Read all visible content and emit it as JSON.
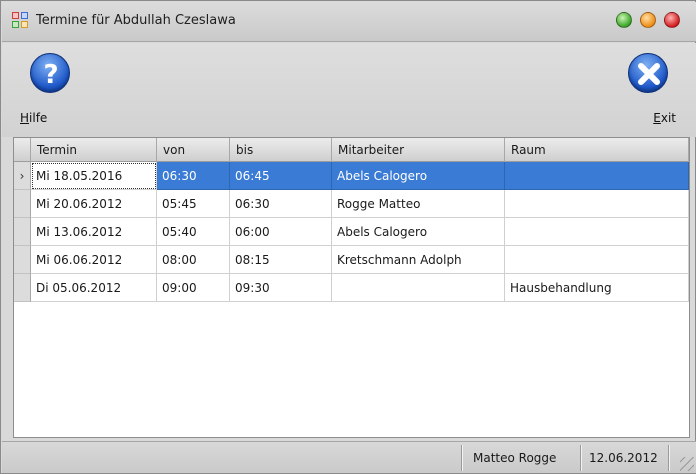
{
  "window": {
    "title": "Termine für Abdullah Czeslawa"
  },
  "toolbar": {
    "help_label": "Hilfe",
    "exit_label": "Exit"
  },
  "grid": {
    "columns": [
      "Termin",
      "von",
      "bis",
      "Mitarbeiter",
      "Raum"
    ],
    "selected_row": 0,
    "current_row_indicator": "›",
    "rows": [
      {
        "termin": "Mi 18.05.2016",
        "von": "06:30",
        "bis": "06:45",
        "mitarbeiter": "Abels Calogero",
        "raum": ""
      },
      {
        "termin": "Mi 20.06.2012",
        "von": "05:45",
        "bis": "06:30",
        "mitarbeiter": "Rogge Matteo",
        "raum": ""
      },
      {
        "termin": "Mi 13.06.2012",
        "von": "05:40",
        "bis": "06:00",
        "mitarbeiter": "Abels Calogero",
        "raum": ""
      },
      {
        "termin": "Mi 06.06.2012",
        "von": "08:00",
        "bis": "08:15",
        "mitarbeiter": "Kretschmann Adolph",
        "raum": ""
      },
      {
        "termin": "Di 05.06.2012",
        "von": "09:00",
        "bis": "09:30",
        "mitarbeiter": "",
        "raum": "Hausbehandlung"
      }
    ]
  },
  "statusbar": {
    "user": "Matteo Rogge",
    "date": "12.06.2012"
  },
  "icons": {
    "help": "question-mark-icon",
    "exit": "close-x-icon",
    "app": "app-grid-icon"
  },
  "colors": {
    "selection": "#3a7bd5",
    "icon_blue": "#1d57c8"
  }
}
